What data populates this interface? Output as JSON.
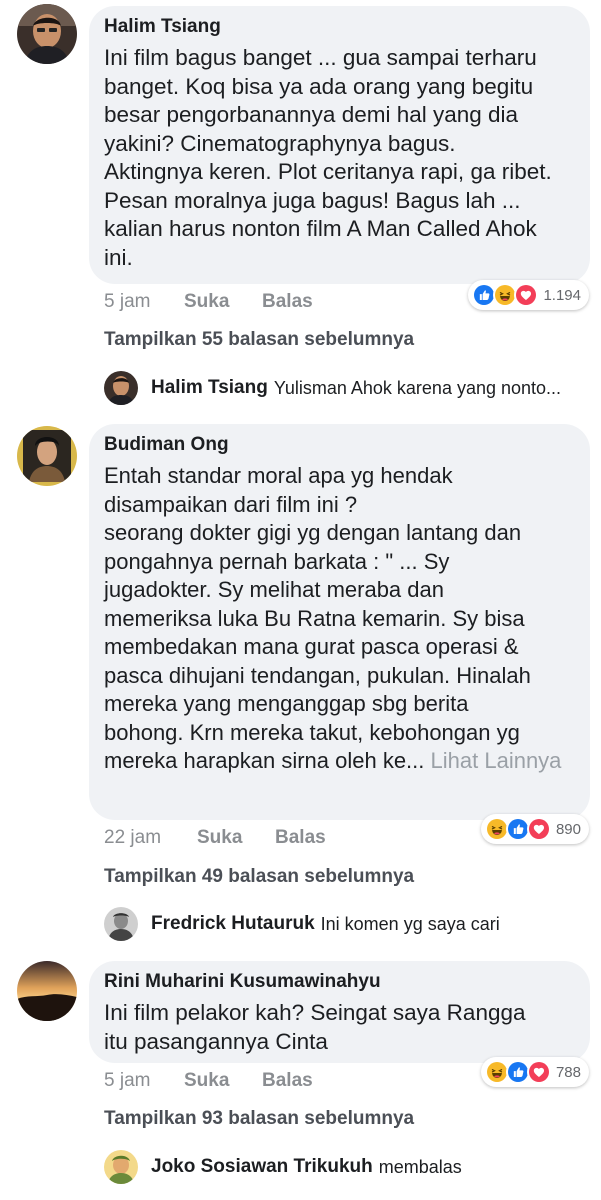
{
  "comments": [
    {
      "author": "Halim Tsiang",
      "lines": [
        "Ini film bagus banget ... gua sampai terharu",
        "banget. Koq bisa ya ada orang yang begitu",
        "besar pengorbanannya demi hal yang dia",
        "yakini? Cinematographynya bagus.",
        "Aktingnya keren. Plot ceritanya rapi, ga ribet.",
        "Pesan moralnya juga bagus! Bagus lah ...",
        "kalian harus nonton film A Man Called Ahok",
        "ini."
      ],
      "time": "5 jam",
      "like_label": "Suka",
      "reply_label": "Balas",
      "reaction_count": "1.194",
      "reactions": [
        "like-icon",
        "haha-icon",
        "love-icon"
      ],
      "view_replies": "Tampilkan 55 balasan sebelumnya",
      "latest_reply": {
        "name": "Halim Tsiang",
        "text": "Yulisman Ahok karena yang nonto..."
      }
    },
    {
      "author": "Budiman Ong",
      "lines": [
        "Entah standar moral apa yg hendak",
        "disampaikan dari film ini ?",
        "seorang dokter gigi yg dengan lantang dan",
        "pongahnya pernah barkata : \" ... Sy",
        "jugadokter. Sy melihat meraba dan",
        "memeriksa luka Bu Ratna kemarin. Sy bisa",
        "membedakan mana gurat pasca operasi &",
        "pasca dihujani tendangan, pukulan. Hinalah",
        "mereka yang menganggap sbg berita",
        "bohong. Krn mereka takut, kebohongan yg",
        "mereka harapkan sirna oleh ke..."
      ],
      "see_more": "Lihat Lainnya",
      "time": "22 jam",
      "like_label": "Suka",
      "reply_label": "Balas",
      "reaction_count": "890",
      "reactions": [
        "haha-icon",
        "like-icon",
        "love-icon"
      ],
      "view_replies": "Tampilkan 49 balasan sebelumnya",
      "latest_reply": {
        "name": "Fredrick Hutauruk",
        "text": "Ini komen yg saya cari"
      }
    },
    {
      "author": "Rini Muharini Kusumawinahyu",
      "lines": [
        "Ini film pelakor kah?  Seingat saya Rangga",
        "itu pasangannya Cinta"
      ],
      "time": "5 jam",
      "like_label": "Suka",
      "reply_label": "Balas",
      "reaction_count": "788",
      "reactions": [
        "haha-icon",
        "like-icon",
        "love-icon"
      ],
      "view_replies": "Tampilkan 93 balasan sebelumnya",
      "latest_reply": {
        "name": "Joko Sosiawan Trikukuh",
        "text": "membalas"
      }
    }
  ],
  "colors": {
    "bubble": "#f0f2f5",
    "like_blue": "#1877f2",
    "love_red": "#f33e58",
    "haha_yellow": "#f7b928",
    "meta_gray": "#8a8d91"
  }
}
